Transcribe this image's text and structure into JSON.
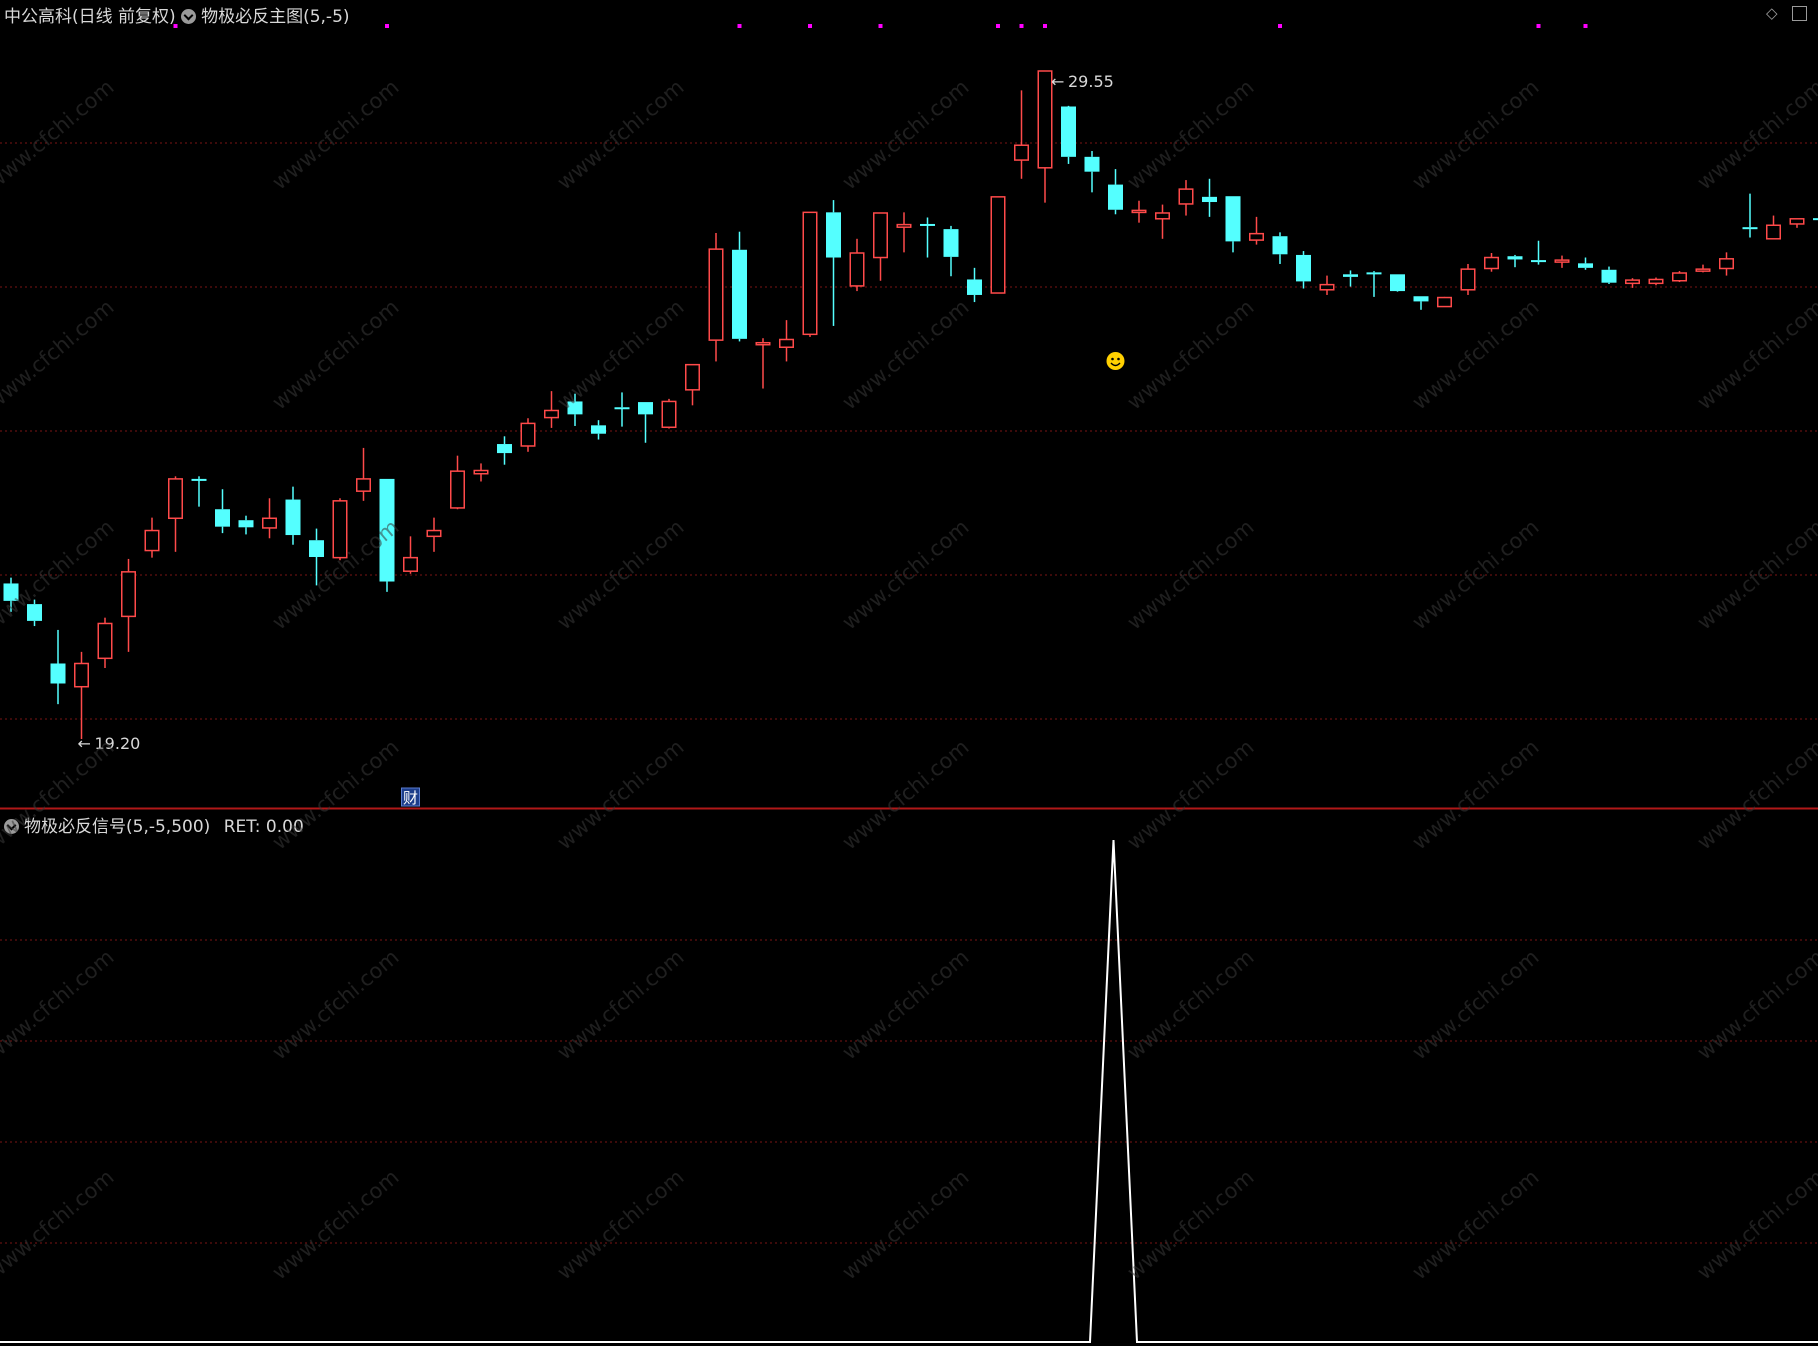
{
  "main_header": {
    "stock": "中公高科",
    "period": "(日线 前复权)",
    "indicator": "物极必反主图(5,-5)"
  },
  "sub_header": {
    "indicator": "物极必反信号(5,-5,500)",
    "ret": "RET: 0.00"
  },
  "annotations": {
    "high_label": "29.55",
    "low_label": "19.20",
    "cai_badge": "财"
  },
  "watermark": "www.cfchi.com",
  "colors": {
    "up": "#ff4a4a",
    "down": "#54ffff",
    "grid": "#7a1414",
    "divider": "#b01818",
    "signal_line": "#ffffff",
    "marker": "#ff00ff",
    "smiley": "#ffd000"
  },
  "icons": [
    "dropdown-circle-icon",
    "smiley-icon",
    "diamond-icon",
    "window-icon",
    "arrow-left-icon"
  ],
  "chart_data": [
    {
      "type": "candlestick",
      "title": "物极必反主图(5,-5)",
      "ylim": [
        18.1,
        30.65
      ],
      "high_value": 29.55,
      "low_value": 19.2,
      "high_index": 44,
      "low_index": 3,
      "smiley_index": 47,
      "marker_indices": [
        7,
        16,
        31,
        34,
        37,
        42,
        43,
        44,
        54,
        65,
        67
      ],
      "cai_index": 17,
      "candles": [
        {
          "o": 21.61,
          "c": 21.34,
          "h": 21.7,
          "l": 21.17
        },
        {
          "o": 21.29,
          "c": 21.03,
          "h": 21.36,
          "l": 20.95
        },
        {
          "o": 20.37,
          "c": 20.06,
          "h": 20.89,
          "l": 19.74
        },
        {
          "o": 20.01,
          "c": 20.37,
          "h": 20.55,
          "l": 19.2
        },
        {
          "o": 20.45,
          "c": 20.99,
          "h": 21.08,
          "l": 20.3
        },
        {
          "o": 21.1,
          "c": 21.79,
          "h": 21.99,
          "l": 20.55
        },
        {
          "o": 22.12,
          "c": 22.43,
          "h": 22.63,
          "l": 22.01
        },
        {
          "o": 22.62,
          "c": 23.23,
          "h": 23.27,
          "l": 22.1
        },
        {
          "o": 23.23,
          "c": 23.21,
          "h": 23.27,
          "l": 22.8
        },
        {
          "o": 22.76,
          "c": 22.49,
          "h": 23.07,
          "l": 22.39
        },
        {
          "o": 22.59,
          "c": 22.48,
          "h": 22.66,
          "l": 22.37
        },
        {
          "o": 22.47,
          "c": 22.62,
          "h": 22.93,
          "l": 22.31
        },
        {
          "o": 22.91,
          "c": 22.36,
          "h": 23.11,
          "l": 22.21
        },
        {
          "o": 22.28,
          "c": 22.02,
          "h": 22.46,
          "l": 21.58
        },
        {
          "o": 22.01,
          "c": 22.89,
          "h": 22.93,
          "l": 21.97
        },
        {
          "o": 23.04,
          "c": 23.23,
          "h": 23.71,
          "l": 22.89
        },
        {
          "o": 23.23,
          "c": 21.64,
          "h": 23.23,
          "l": 21.48
        },
        {
          "o": 21.8,
          "c": 22.01,
          "h": 22.34,
          "l": 21.76
        },
        {
          "o": 22.34,
          "c": 22.43,
          "h": 22.63,
          "l": 22.1
        },
        {
          "o": 22.78,
          "c": 23.35,
          "h": 23.59,
          "l": 22.76
        },
        {
          "o": 23.31,
          "c": 23.36,
          "h": 23.47,
          "l": 23.19
        },
        {
          "o": 23.77,
          "c": 23.63,
          "h": 23.89,
          "l": 23.45
        },
        {
          "o": 23.74,
          "c": 24.09,
          "h": 24.17,
          "l": 23.65
        },
        {
          "o": 24.18,
          "c": 24.29,
          "h": 24.59,
          "l": 24.02
        },
        {
          "o": 24.43,
          "c": 24.23,
          "h": 24.55,
          "l": 24.05
        },
        {
          "o": 24.06,
          "c": 23.93,
          "h": 24.14,
          "l": 23.84
        },
        {
          "o": 24.34,
          "c": 24.32,
          "h": 24.57,
          "l": 24.04
        },
        {
          "o": 24.42,
          "c": 24.23,
          "h": 24.42,
          "l": 23.79
        },
        {
          "o": 24.03,
          "c": 24.43,
          "h": 24.47,
          "l": 24.01
        },
        {
          "o": 24.61,
          "c": 25.0,
          "h": 25.0,
          "l": 24.37
        },
        {
          "o": 25.38,
          "c": 26.79,
          "h": 27.04,
          "l": 25.05
        },
        {
          "o": 26.78,
          "c": 25.4,
          "h": 27.06,
          "l": 25.36
        },
        {
          "o": 25.31,
          "c": 25.34,
          "h": 25.41,
          "l": 24.63
        },
        {
          "o": 25.27,
          "c": 25.39,
          "h": 25.69,
          "l": 25.05
        },
        {
          "o": 25.47,
          "c": 27.36,
          "h": 27.36,
          "l": 25.43
        },
        {
          "o": 27.36,
          "c": 26.66,
          "h": 27.55,
          "l": 25.6
        },
        {
          "o": 26.22,
          "c": 26.73,
          "h": 26.95,
          "l": 26.14
        },
        {
          "o": 26.66,
          "c": 27.35,
          "h": 27.35,
          "l": 26.3
        },
        {
          "o": 27.13,
          "c": 27.17,
          "h": 27.36,
          "l": 26.74
        },
        {
          "o": 27.18,
          "c": 27.16,
          "h": 27.28,
          "l": 26.66
        },
        {
          "o": 27.1,
          "c": 26.67,
          "h": 27.15,
          "l": 26.37
        },
        {
          "o": 26.32,
          "c": 26.08,
          "h": 26.5,
          "l": 25.97
        },
        {
          "o": 26.11,
          "c": 27.6,
          "h": 27.6,
          "l": 26.11
        },
        {
          "o": 28.17,
          "c": 28.4,
          "h": 29.25,
          "l": 27.88
        },
        {
          "o": 28.05,
          "c": 29.55,
          "h": 29.55,
          "l": 27.51
        },
        {
          "o": 29.0,
          "c": 28.22,
          "h": 29.01,
          "l": 28.11
        },
        {
          "o": 28.22,
          "c": 27.99,
          "h": 28.31,
          "l": 27.67
        },
        {
          "o": 27.79,
          "c": 27.4,
          "h": 28.03,
          "l": 27.33
        },
        {
          "o": 27.36,
          "c": 27.39,
          "h": 27.54,
          "l": 27.2
        },
        {
          "o": 27.26,
          "c": 27.35,
          "h": 27.48,
          "l": 26.95
        },
        {
          "o": 27.49,
          "c": 27.72,
          "h": 27.86,
          "l": 27.31
        },
        {
          "o": 27.6,
          "c": 27.52,
          "h": 27.88,
          "l": 27.29
        },
        {
          "o": 27.61,
          "c": 26.91,
          "h": 27.61,
          "l": 26.74
        },
        {
          "o": 26.93,
          "c": 27.03,
          "h": 27.29,
          "l": 26.86
        },
        {
          "o": 26.99,
          "c": 26.71,
          "h": 27.05,
          "l": 26.56
        },
        {
          "o": 26.7,
          "c": 26.29,
          "h": 26.76,
          "l": 26.18
        },
        {
          "o": 26.16,
          "c": 26.24,
          "h": 26.38,
          "l": 26.08
        },
        {
          "o": 26.4,
          "c": 26.36,
          "h": 26.46,
          "l": 26.21
        },
        {
          "o": 26.43,
          "c": 26.42,
          "h": 26.45,
          "l": 26.05
        },
        {
          "o": 26.4,
          "c": 26.14,
          "h": 26.4,
          "l": 26.13
        },
        {
          "o": 26.06,
          "c": 25.98,
          "h": 26.06,
          "l": 25.85
        },
        {
          "o": 25.9,
          "c": 26.04,
          "h": 26.05,
          "l": 25.95
        },
        {
          "o": 26.16,
          "c": 26.48,
          "h": 26.56,
          "l": 26.08
        },
        {
          "o": 26.49,
          "c": 26.66,
          "h": 26.73,
          "l": 26.44
        },
        {
          "o": 26.68,
          "c": 26.63,
          "h": 26.7,
          "l": 26.51
        },
        {
          "o": 26.62,
          "c": 26.61,
          "h": 26.92,
          "l": 26.55
        },
        {
          "o": 26.61,
          "c": 26.62,
          "h": 26.69,
          "l": 26.5
        },
        {
          "o": 26.57,
          "c": 26.5,
          "h": 26.66,
          "l": 26.47
        },
        {
          "o": 26.47,
          "c": 26.27,
          "h": 26.52,
          "l": 26.25
        },
        {
          "o": 26.26,
          "c": 26.31,
          "h": 26.34,
          "l": 26.19
        },
        {
          "o": 26.26,
          "c": 26.32,
          "h": 26.35,
          "l": 26.23
        },
        {
          "o": 26.3,
          "c": 26.42,
          "h": 26.45,
          "l": 26.28
        },
        {
          "o": 26.45,
          "c": 26.48,
          "h": 26.55,
          "l": 26.43
        },
        {
          "o": 26.49,
          "c": 26.64,
          "h": 26.74,
          "l": 26.38
        },
        {
          "o": 27.13,
          "c": 27.1,
          "h": 27.65,
          "l": 26.97
        },
        {
          "o": 26.95,
          "c": 27.16,
          "h": 27.31,
          "l": 26.95
        },
        {
          "o": 27.18,
          "c": 27.26,
          "h": 27.26,
          "l": 27.12
        },
        {
          "o": 27.27,
          "c": 27.24,
          "h": 27.34,
          "l": 27.12
        }
      ]
    },
    {
      "type": "line",
      "title": "物极必反信号(5,-5,500)",
      "ylim": [
        0,
        500
      ],
      "series": [
        {
          "x": [
            0,
            46,
            47,
            48,
            77
          ],
          "y": [
            0,
            0,
            500,
            0,
            0
          ]
        }
      ]
    }
  ]
}
